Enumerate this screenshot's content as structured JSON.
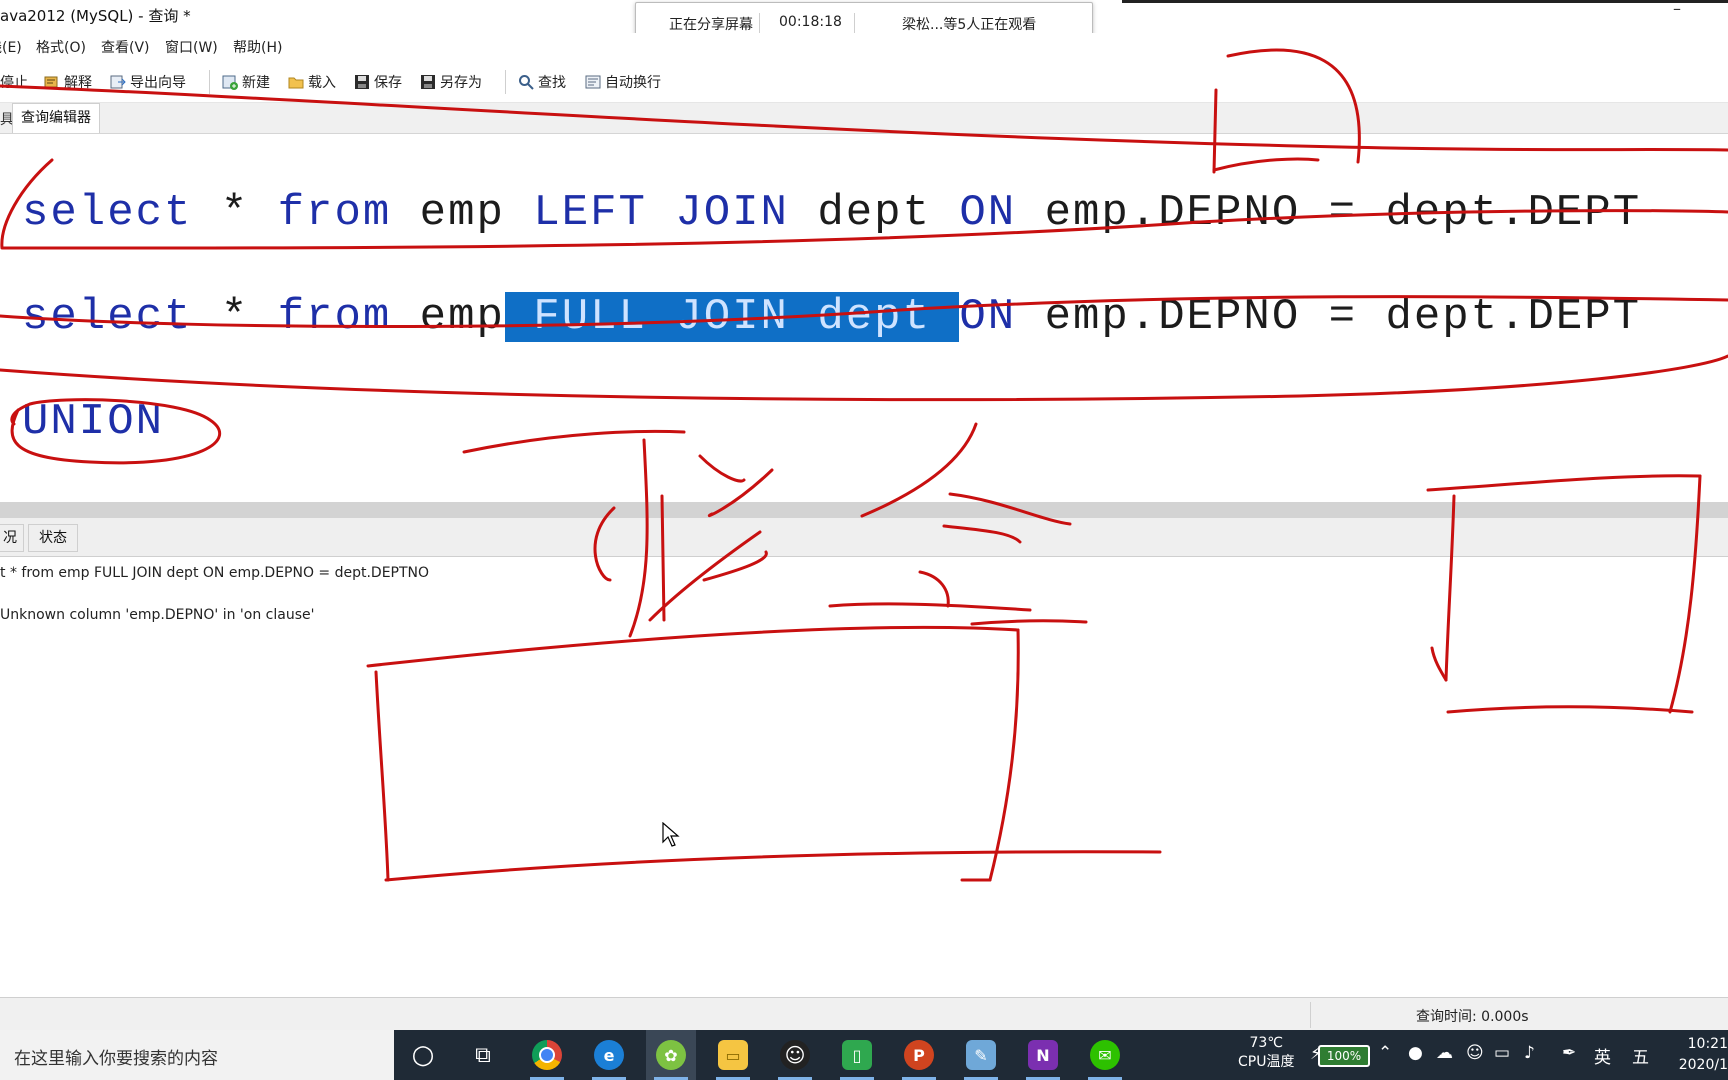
{
  "window": {
    "title": "ava2012 (MySQL) - 查询 *",
    "minimize_glyph": "–"
  },
  "share_banner": {
    "status": "正在分享屏幕",
    "elapsed": "00:18:18",
    "viewers": "梁松...等5人正在观看"
  },
  "menu": {
    "items": [
      "钱(E)",
      "格式(O)",
      "查看(V)",
      "窗口(W)",
      "帮助(H)"
    ]
  },
  "toolbar": {
    "stop": "停止",
    "explain": "解释",
    "export_wizard": "导出向导",
    "new": "新建",
    "load": "载入",
    "save": "保存",
    "save_as": "另存为",
    "find": "查找",
    "word_wrap": "自动换行",
    "icons": {
      "stop": "stop-icon",
      "explain": "explain-icon",
      "export": "export-icon",
      "new": "new-query-icon",
      "load": "folder-icon",
      "save": "floppy-icon",
      "save_as": "floppy-icon",
      "find": "magnifier-icon",
      "word_wrap": "wrap-icon"
    }
  },
  "tabs": {
    "left_fragment": "具",
    "query_editor": "查询编辑器"
  },
  "editor": {
    "line1": {
      "kw_select": "select",
      "star": " * ",
      "kw_from": "from",
      "emp": " emp ",
      "kw_left_join": "LEFT JOIN",
      "dept": " dept ",
      "kw_on": "ON",
      "rest": " emp.DEPNO = dept.DEPT"
    },
    "line2": {
      "kw_select": "select",
      "star": " * ",
      "kw_from": "from",
      "emp": " emp",
      "selected": " FULL JOIN dept ",
      "kw_on": "ON",
      "rest": " emp.DEPNO = dept.DEPT"
    },
    "line3": {
      "kw_union": "UNION"
    },
    "colors": {
      "keyword": "#1e2fa8",
      "selection": "#0f6fc6"
    }
  },
  "result_tabs": {
    "info": "况",
    "status": "状态"
  },
  "messages": {
    "line1": "t * from emp FULL JOIN dept ON emp.DEPNO = dept.DEPTNO",
    "line2": "Unknown column 'emp.DEPNO' in 'on clause'"
  },
  "status_bar": {
    "query_time": "查询时间: 0.000s"
  },
  "taskbar": {
    "search_placeholder": "在这里输入你要搜索的内容",
    "apps": [
      {
        "name": "cortana-icon",
        "glyph": "○"
      },
      {
        "name": "task-view-icon",
        "glyph": "⧉"
      },
      {
        "name": "chrome-icon",
        "glyph": "◉"
      },
      {
        "name": "edge-icon",
        "glyph": "e"
      },
      {
        "name": "navicat-icon",
        "glyph": "✿"
      },
      {
        "name": "file-explorer-icon",
        "glyph": "▭"
      },
      {
        "name": "qq-icon",
        "glyph": "☺"
      },
      {
        "name": "green-app-icon",
        "glyph": "▯"
      },
      {
        "name": "powerpoint-icon",
        "glyph": "P"
      },
      {
        "name": "notepad-icon",
        "glyph": "✎"
      },
      {
        "name": "onenote-icon",
        "glyph": "N"
      },
      {
        "name": "wechat-icon",
        "glyph": "✉"
      }
    ],
    "cpu_temp": "73℃",
    "cpu_label": "CPU温度",
    "battery": "100%",
    "ime_lang": "英",
    "ime_mode": "五",
    "clock_time": "10:21",
    "clock_date": "2020/1"
  }
}
